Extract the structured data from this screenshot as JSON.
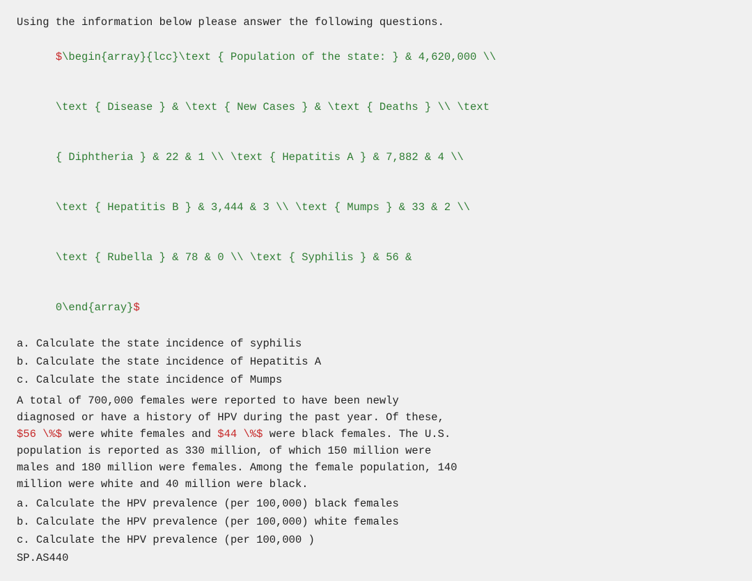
{
  "intro": {
    "line1": "Using the information below please answer the following questions.",
    "mathLine1": "$\\begin{array}{lcc}\\text { Population of the state: } & 4,620,000 \\\\",
    "mathLine2": "\\text { Disease } & \\text { New Cases } & \\text { Deaths } \\\\ \\text",
    "mathLine3": "{ Diphtheria } & 22 & 1 \\\\ \\text { Hepatitis A } & 7,882 & 4 \\\\",
    "mathLine4": "\\text { Hepatitis B } & 3,444 & 3 \\\\ \\text { Mumps } & 33 & 2 \\\\",
    "mathLine5": "\\text { Rubella } & 78 & 0 \\\\ \\text { Syphilis } & 56 &",
    "mathLine6": "0\\end{array}$"
  },
  "questions1": {
    "label_a": "a. Calculate the state incidence of syphilis",
    "label_b": "b. Calculate the state incidence of Hepatitis A",
    "label_c": "c. Calculate the state incidence of Mumps"
  },
  "paragraph1": {
    "line1": "A total of 700,000 females were reported to have been newly",
    "line2": "diagnosed or have a history of HPV during the past year. Of these,",
    "line3_start": "",
    "line3_math1": "$56 \\%$",
    "line3_mid": " were white females and ",
    "line3_math2": "$44 \\%$",
    "line3_end": " were black females. The U.S.",
    "line4": "population is reported as 330 million, of which 150 million were",
    "line5": "males and 180 million were females. Among the female population, 140",
    "line6": "million were white and 40 million were black."
  },
  "questions2": {
    "label_a": "a. Calculate the HPV prevalence (per 100,000) black females",
    "label_b": "b. Calculate the HPV prevalence (per 100,000) white females",
    "label_c": "c. Calculate the HPV prevalence (per 100,000 )",
    "label_d": "SP.AS440"
  }
}
